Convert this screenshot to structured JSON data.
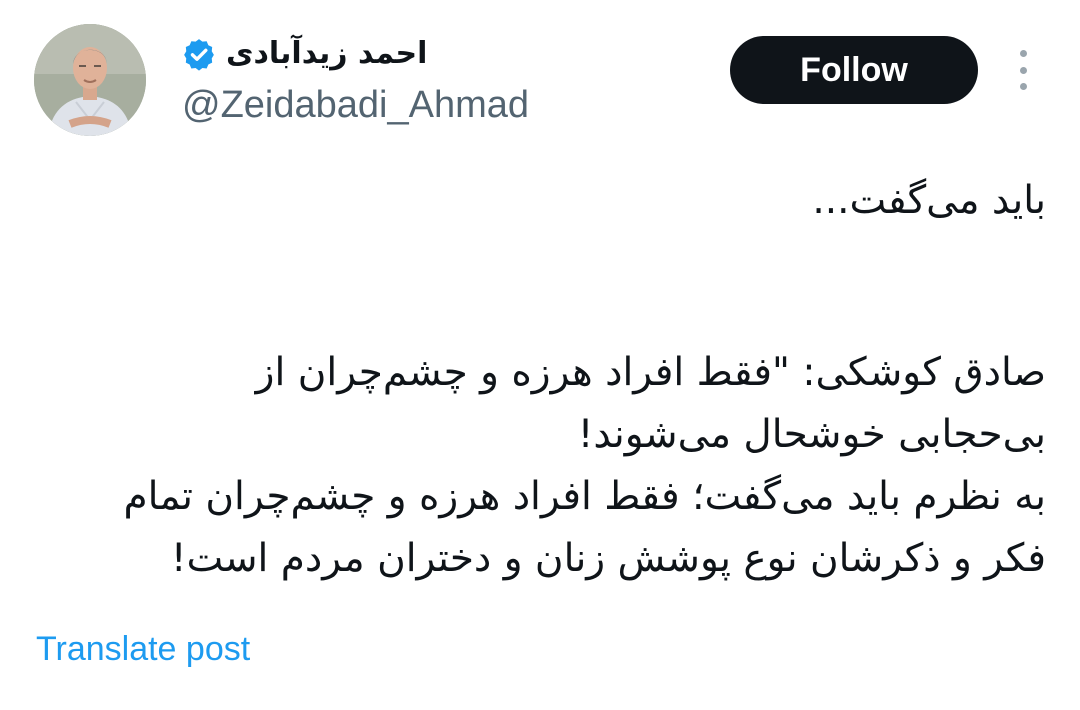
{
  "author": {
    "display_name": "احمد زیدآبادی",
    "handle": "@Zeidabadi_Ahmad",
    "verified": true,
    "verified_icon": "verified-badge-icon",
    "verified_color": "#1d9bf0"
  },
  "actions": {
    "follow_label": "Follow",
    "more_icon": "more-vertical-icon"
  },
  "tweet": {
    "lines": [
      "باید می‌گفت...",
      "",
      "صادق کوشکی: \"فقط افراد هرزه و چشم‌چران از",
      "بی‌حجابی خوشحال می‌شوند!",
      "به نظرم باید می‌گفت؛ فقط افراد هرزه و چشم‌چران تمام",
      "فکر و ذکرشان نوع پوشش زنان و دختران مردم است!"
    ]
  },
  "translate": {
    "label": "Translate post",
    "color": "#1d9bf0"
  }
}
